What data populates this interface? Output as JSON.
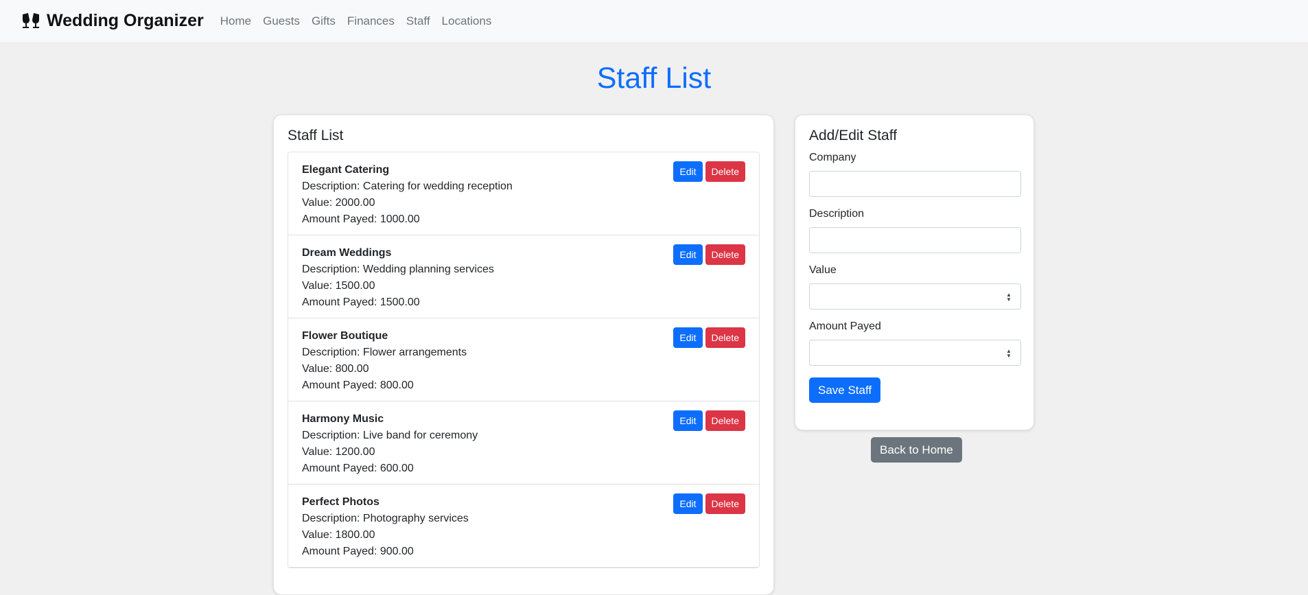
{
  "nav": {
    "brand": "Wedding Organizer",
    "brand_icon": "glasses-toast-icon",
    "links": [
      "Home",
      "Guests",
      "Gifts",
      "Finances",
      "Staff",
      "Locations"
    ]
  },
  "page_title": "Staff List",
  "list_card": {
    "title": "Staff List",
    "edit_label": "Edit",
    "delete_label": "Delete",
    "items": [
      {
        "name": "Elegant Catering",
        "description": "Description: Catering for wedding reception",
        "value": "Value: 2000.00",
        "payed": "Amount Payed: 1000.00"
      },
      {
        "name": "Dream Weddings",
        "description": "Description: Wedding planning services",
        "value": "Value: 1500.00",
        "payed": "Amount Payed: 1500.00"
      },
      {
        "name": "Flower Boutique",
        "description": "Description: Flower arrangements",
        "value": "Value: 800.00",
        "payed": "Amount Payed: 800.00"
      },
      {
        "name": "Harmony Music",
        "description": "Description: Live band for ceremony",
        "value": "Value: 1200.00",
        "payed": "Amount Payed: 600.00"
      },
      {
        "name": "Perfect Photos",
        "description": "Description: Photography services",
        "value": "Value: 1800.00",
        "payed": "Amount Payed: 900.00"
      }
    ]
  },
  "form_card": {
    "title": "Add/Edit Staff",
    "company_label": "Company",
    "company_value": "",
    "description_label": "Description",
    "description_value": "",
    "value_label": "Value",
    "value_value": "",
    "payed_label": "Amount Payed",
    "payed_value": "",
    "save_label": "Save Staff"
  },
  "back_label": "Back to Home",
  "colors": {
    "primary": "#0d6efd",
    "danger": "#dc3545",
    "secondary": "#6c757d"
  }
}
